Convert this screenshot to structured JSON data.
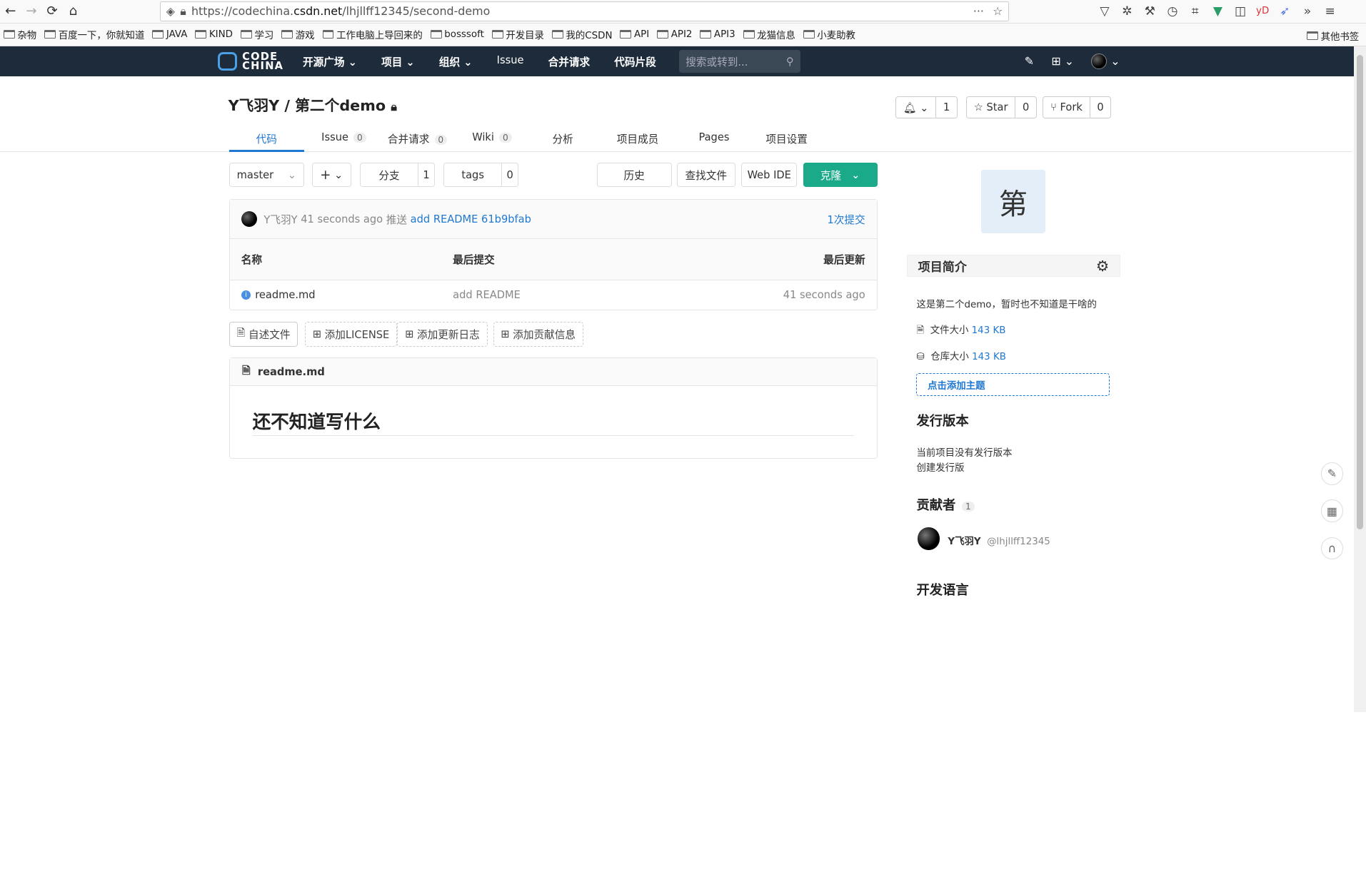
{
  "browser": {
    "url_prefix": "https://codechina.",
    "url_host": "csdn.net",
    "url_path": "/lhjllff12345/second-demo",
    "bookmarks": [
      "杂物",
      "百度一下，你就知道",
      "JAVA",
      "KIND",
      "学习",
      "游戏",
      "工作电脑上导回来的",
      "bosssoft",
      "开发目录",
      "我的CSDN",
      "API",
      "API2",
      "API3",
      "龙猫信息",
      "小麦助教"
    ],
    "bookmarks_other": "其他书签"
  },
  "topnav": {
    "logo_line1": "CODE",
    "logo_line2": "CHINA",
    "menu": [
      "开源广场",
      "项目",
      "组织",
      "Issue",
      "合并请求",
      "代码片段"
    ],
    "search_placeholder": "搜索或转到..."
  },
  "project": {
    "title": "Y飞羽Y / 第二个demo",
    "notify_count": "1",
    "star_label": "Star",
    "star_count": "0",
    "fork_label": "Fork",
    "fork_count": "0"
  },
  "tabs": {
    "code": "代码",
    "issue": "Issue",
    "issue_count": "0",
    "mr": "合并请求",
    "mr_count": "0",
    "wiki": "Wiki",
    "wiki_count": "0",
    "analytics": "分析",
    "members": "项目成员",
    "pages": "Pages",
    "settings": "项目设置"
  },
  "toolbar": {
    "branch": "master",
    "add": "+",
    "branches_label": "分支",
    "branches_count": "1",
    "tags_label": "tags",
    "tags_count": "0",
    "history": "历史",
    "find_file": "查找文件",
    "web_ide": "Web IDE",
    "clone": "克隆"
  },
  "commit": {
    "author": "Y飞羽Y",
    "time": "41 seconds ago",
    "action": "推送",
    "message": "add README",
    "sha": "61b9bfab",
    "count": "1次提交"
  },
  "files": {
    "headers": [
      "名称",
      "最后提交",
      "最后更新"
    ],
    "rows": [
      {
        "name": "readme.md",
        "commit": "add README",
        "updated": "41 seconds ago"
      }
    ]
  },
  "add_buttons": [
    "自述文件",
    "添加LICENSE",
    "添加更新日志",
    "添加贡献信息"
  ],
  "readme": {
    "filename": "readme.md",
    "heading": "还不知道写什么"
  },
  "sidebar": {
    "avatar_char": "第",
    "intro_title": "项目简介",
    "description": "这是第二个demo，暂时也不知道是干啥的",
    "file_size_label": "文件大小",
    "file_size": "143 KB",
    "repo_size_label": "仓库大小",
    "repo_size": "143 KB",
    "add_topic": "点击添加主题",
    "releases_title": "发行版本",
    "no_releases": "当前项目没有发行版本",
    "create_release": "创建发行版",
    "contributors_title": "贡献者",
    "contributors_count": "1",
    "contributor_name": "Y飞羽Y",
    "contributor_handle": "@lhjllff12345",
    "languages_title": "开发语言"
  }
}
